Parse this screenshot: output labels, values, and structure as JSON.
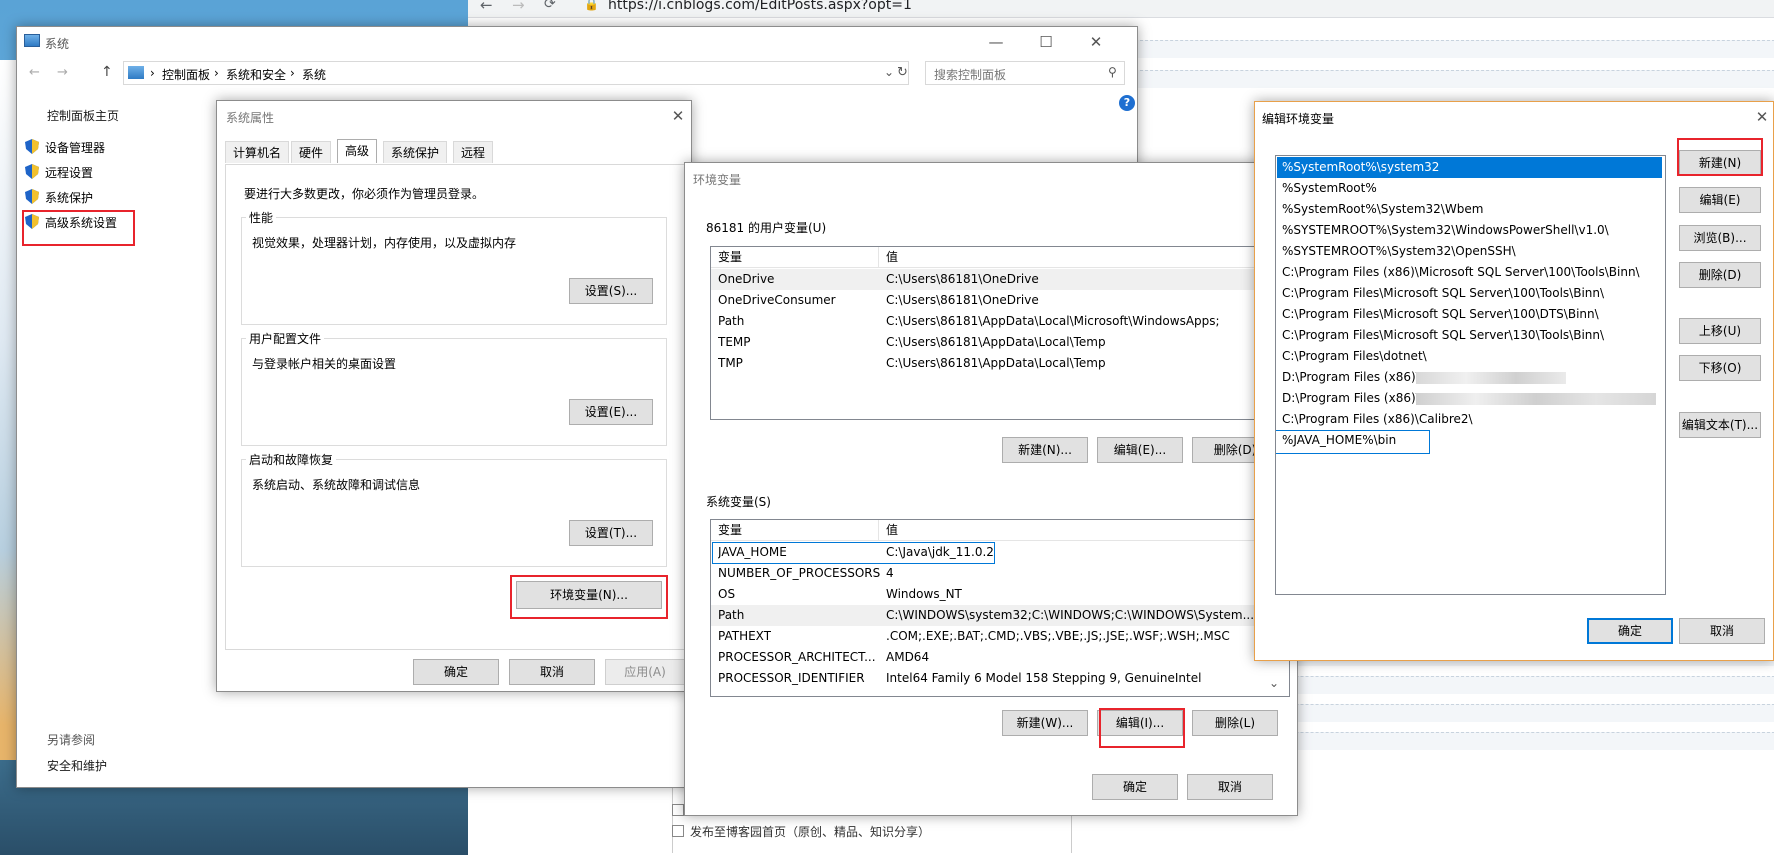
{
  "browser": {
    "url": "https://i.cnblogs.com/EditPosts.aspx?opt=1",
    "footer_checkbox_label": "发布至博客园首页（原创、精品、知识分享）"
  },
  "control_panel": {
    "window_title": "系统",
    "breadcrumb": [
      "控制面板",
      "系统和安全",
      "系统"
    ],
    "search_placeholder": "搜索控制面板",
    "home_link": "控制面板主页",
    "nav_items": [
      "设备管理器",
      "远程设置",
      "系统保护",
      "高级系统设置"
    ],
    "see_also_heading": "另请参阅",
    "see_also_items": [
      "安全和维护"
    ]
  },
  "sys_props": {
    "title": "系统属性",
    "tabs": [
      "计算机名",
      "硬件",
      "高级",
      "系统保护",
      "远程"
    ],
    "admin_note": "要进行大多数更改，你必须作为管理员登录。",
    "groups": [
      {
        "title": "性能",
        "desc": "视觉效果，处理器计划，内存使用，以及虚拟内存",
        "button": "设置(S)..."
      },
      {
        "title": "用户配置文件",
        "desc": "与登录帐户相关的桌面设置",
        "button": "设置(E)..."
      },
      {
        "title": "启动和故障恢复",
        "desc": "系统启动、系统故障和调试信息",
        "button": "设置(T)..."
      }
    ],
    "env_button": "环境变量(N)...",
    "ok": "确定",
    "cancel": "取消",
    "apply": "应用(A)"
  },
  "env_vars": {
    "title": "环境变量",
    "user_section": "86181 的用户变量(U)",
    "col_var": "变量",
    "col_val": "值",
    "user_vars": [
      {
        "name": "OneDrive",
        "value": "C:\\Users\\86181\\OneDrive"
      },
      {
        "name": "OneDriveConsumer",
        "value": "C:\\Users\\86181\\OneDrive"
      },
      {
        "name": "Path",
        "value": "C:\\Users\\86181\\AppData\\Local\\Microsoft\\WindowsApps;"
      },
      {
        "name": "TEMP",
        "value": "C:\\Users\\86181\\AppData\\Local\\Temp"
      },
      {
        "name": "TMP",
        "value": "C:\\Users\\86181\\AppData\\Local\\Temp"
      }
    ],
    "user_buttons": [
      "新建(N)...",
      "编辑(E)...",
      "删除(D)"
    ],
    "system_section": "系统变量(S)",
    "system_vars": [
      {
        "name": "JAVA_HOME",
        "value": "C:\\Java\\jdk_11.0.2"
      },
      {
        "name": "NUMBER_OF_PROCESSORS",
        "value": "4"
      },
      {
        "name": "OS",
        "value": "Windows_NT"
      },
      {
        "name": "Path",
        "value": "C:\\WINDOWS\\system32;C:\\WINDOWS;C:\\WINDOWS\\System..."
      },
      {
        "name": "PATHEXT",
        "value": ".COM;.EXE;.BAT;.CMD;.VBS;.VBE;.JS;.JSE;.WSF;.WSH;.MSC"
      },
      {
        "name": "PROCESSOR_ARCHITECT...",
        "value": "AMD64"
      },
      {
        "name": "PROCESSOR_IDENTIFIER",
        "value": "Intel64 Family 6 Model 158 Stepping 9, GenuineIntel"
      }
    ],
    "system_buttons": [
      "新建(W)...",
      "编辑(I)...",
      "删除(L)"
    ],
    "ok": "确定",
    "cancel": "取消"
  },
  "edit_env": {
    "title": "编辑环境变量",
    "entries": [
      "%SystemRoot%\\system32",
      "%SystemRoot%",
      "%SystemRoot%\\System32\\Wbem",
      "%SYSTEMROOT%\\System32\\WindowsPowerShell\\v1.0\\",
      "%SYSTEMROOT%\\System32\\OpenSSH\\",
      "C:\\Program Files (x86)\\Microsoft SQL Server\\100\\Tools\\Binn\\",
      "C:\\Program Files\\Microsoft SQL Server\\100\\Tools\\Binn\\",
      "C:\\Program Files\\Microsoft SQL Server\\100\\DTS\\Binn\\",
      "C:\\Program Files\\Microsoft SQL Server\\130\\Tools\\Binn\\",
      "C:\\Program Files\\dotnet\\",
      "D:\\Program Files (x86)\\",
      "D:\\Program Files (x86)\\",
      "C:\\Program Files (x86)\\Calibre2\\",
      "%JAVA_HOME%\\bin"
    ],
    "buttons": {
      "new": "新建(N)",
      "edit": "编辑(E)",
      "browse": "浏览(B)...",
      "delete": "删除(D)",
      "up": "上移(U)",
      "down": "下移(O)",
      "edit_text": "编辑文本(T)..."
    },
    "ok": "确定",
    "cancel": "取消"
  }
}
